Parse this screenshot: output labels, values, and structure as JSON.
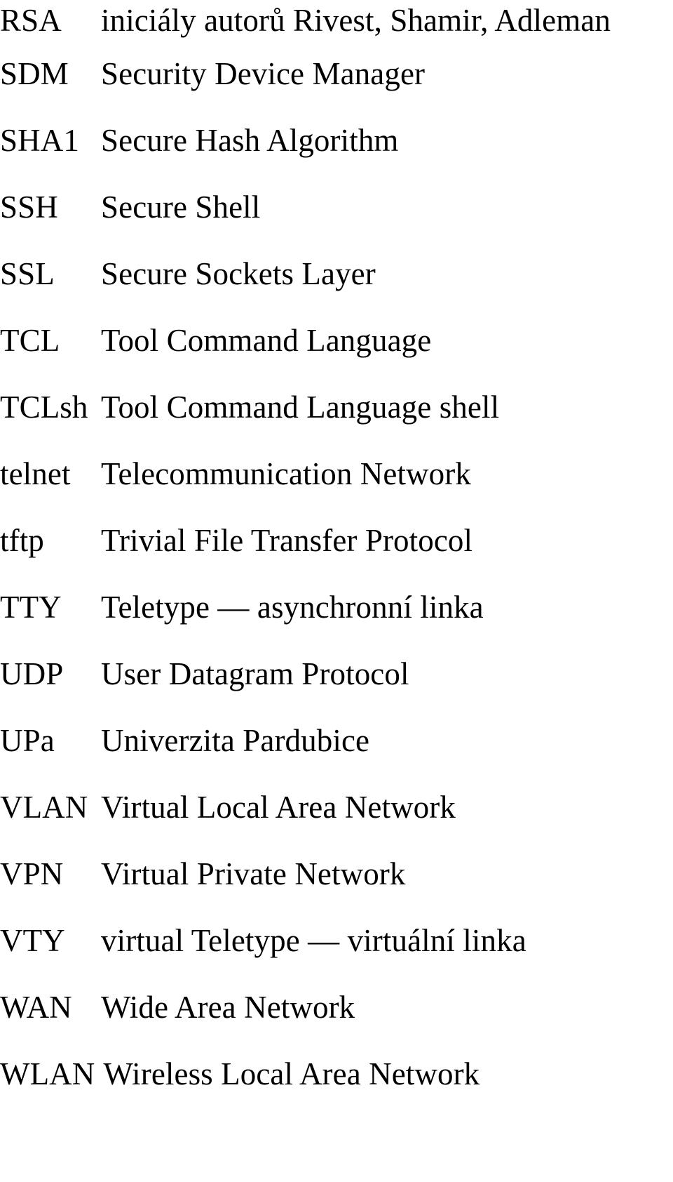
{
  "page": {
    "kind": "abbreviation-glossary",
    "language": "cs",
    "background_color": "#ffffff",
    "text_color": "#000000"
  },
  "glossary": {
    "entries": [
      {
        "term": "RSA",
        "description": "iniciály autorů Rivest, Shamir, Adleman"
      },
      {
        "term": "SDM",
        "description": "Security Device Manager"
      },
      {
        "term": "SHA1",
        "description": "Secure Hash Algorithm"
      },
      {
        "term": "SSH",
        "description": "Secure Shell"
      },
      {
        "term": "SSL",
        "description": "Secure Sockets Layer"
      },
      {
        "term": "TCL",
        "description": "Tool Command Language"
      },
      {
        "term": "TCLsh",
        "description": "Tool Command Language shell"
      },
      {
        "term": "telnet",
        "description": "Telecommunication Network"
      },
      {
        "term": "tftp",
        "description": "Trivial File Transfer Protocol"
      },
      {
        "term": "TTY",
        "description": "Teletype — asynchronní linka"
      },
      {
        "term": "UDP",
        "description": "User Datagram Protocol"
      },
      {
        "term": "UPa",
        "description": "Univerzita Pardubice"
      },
      {
        "term": "VLAN",
        "description": "Virtual Local Area Network"
      },
      {
        "term": "VPN",
        "description": "Virtual Private Network"
      },
      {
        "term": "VTY",
        "description": "virtual Teletype — virtuální linka"
      },
      {
        "term": "WAN",
        "description": "Wide Area Network"
      },
      {
        "term": "WLAN",
        "description": "Wireless Local Area Network"
      }
    ]
  }
}
